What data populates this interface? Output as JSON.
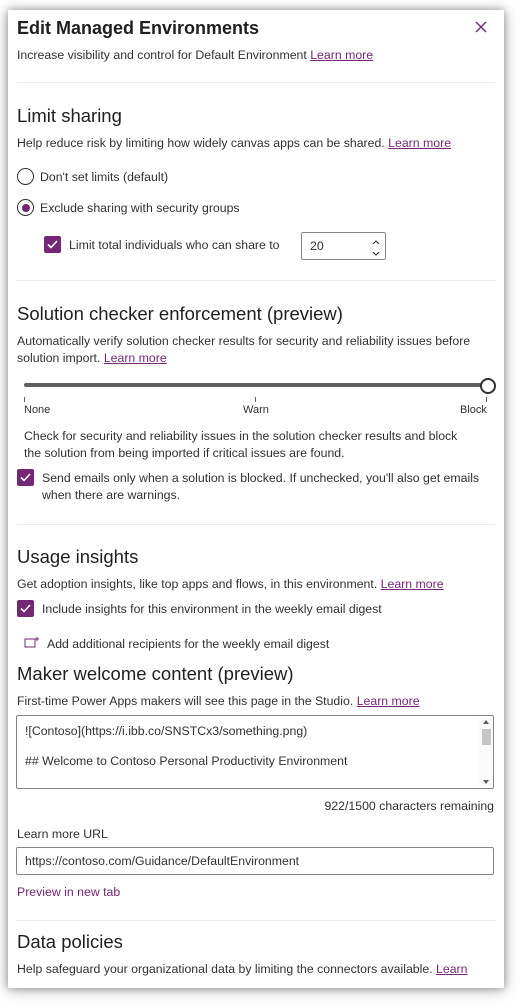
{
  "header": {
    "title": "Edit Managed Environments",
    "subtitle": "Increase visibility and control for Default Environment",
    "learn_more": "Learn more",
    "close_icon": "close-icon"
  },
  "limit_sharing": {
    "heading": "Limit sharing",
    "description": "Help reduce risk by limiting how widely canvas apps can be shared.",
    "learn_more": "Learn more",
    "options": [
      {
        "label": "Don't set limits (default)",
        "selected": false
      },
      {
        "label": "Exclude sharing with security groups",
        "selected": true
      }
    ],
    "limit_individuals": {
      "label": "Limit total individuals who can share to",
      "checked": true,
      "value": "20"
    }
  },
  "solution_checker": {
    "heading": "Solution checker enforcement (preview)",
    "description_line1": "Automatically verify solution checker results for security and reliability issues before",
    "description_line2": "solution import.",
    "learn_more": "Learn more",
    "slider": {
      "labels": [
        "None",
        "Warn",
        "Block"
      ],
      "selected": "Block"
    },
    "block_note_line1": "Check for security and reliability issues in the solution checker results and block",
    "block_note_line2": "the solution from being imported if critical issues are found.",
    "email_option": {
      "checked": true,
      "line1": "Send emails only when a solution is blocked. If unchecked, you'll also get emails",
      "line2": "when there are warnings."
    }
  },
  "usage_insights": {
    "heading": "Usage insights",
    "description": "Get adoption insights, like top apps and flows, in this environment.",
    "learn_more": "Learn more",
    "include_insights": {
      "checked": true,
      "label": "Include insights for this environment in the weekly email digest"
    },
    "add_recipients": {
      "icon": "add-recipient-icon",
      "label": "Add additional recipients for the weekly email digest"
    }
  },
  "maker_welcome": {
    "heading": "Maker welcome content (preview)",
    "description": "First-time Power Apps makers will see this page in the Studio.",
    "learn_more": "Learn more",
    "content_line1": "![Contoso](https://i.ibb.co/SNSTCx3/something.png)",
    "content_line2": "## Welcome to Contoso Personal Productivity Environment",
    "char_count": "922/1500 characters remaining",
    "url_label": "Learn more URL",
    "url_value": "https://contoso.com/Guidance/DefaultEnvironment",
    "preview_link": "Preview in new tab"
  },
  "data_policies": {
    "heading": "Data policies",
    "description": "Help safeguard your organizational data by limiting the connectors available.",
    "learn_more": "Learn"
  },
  "colors": {
    "accent": "#742774",
    "text": "#323130",
    "border": "#8a8886"
  }
}
